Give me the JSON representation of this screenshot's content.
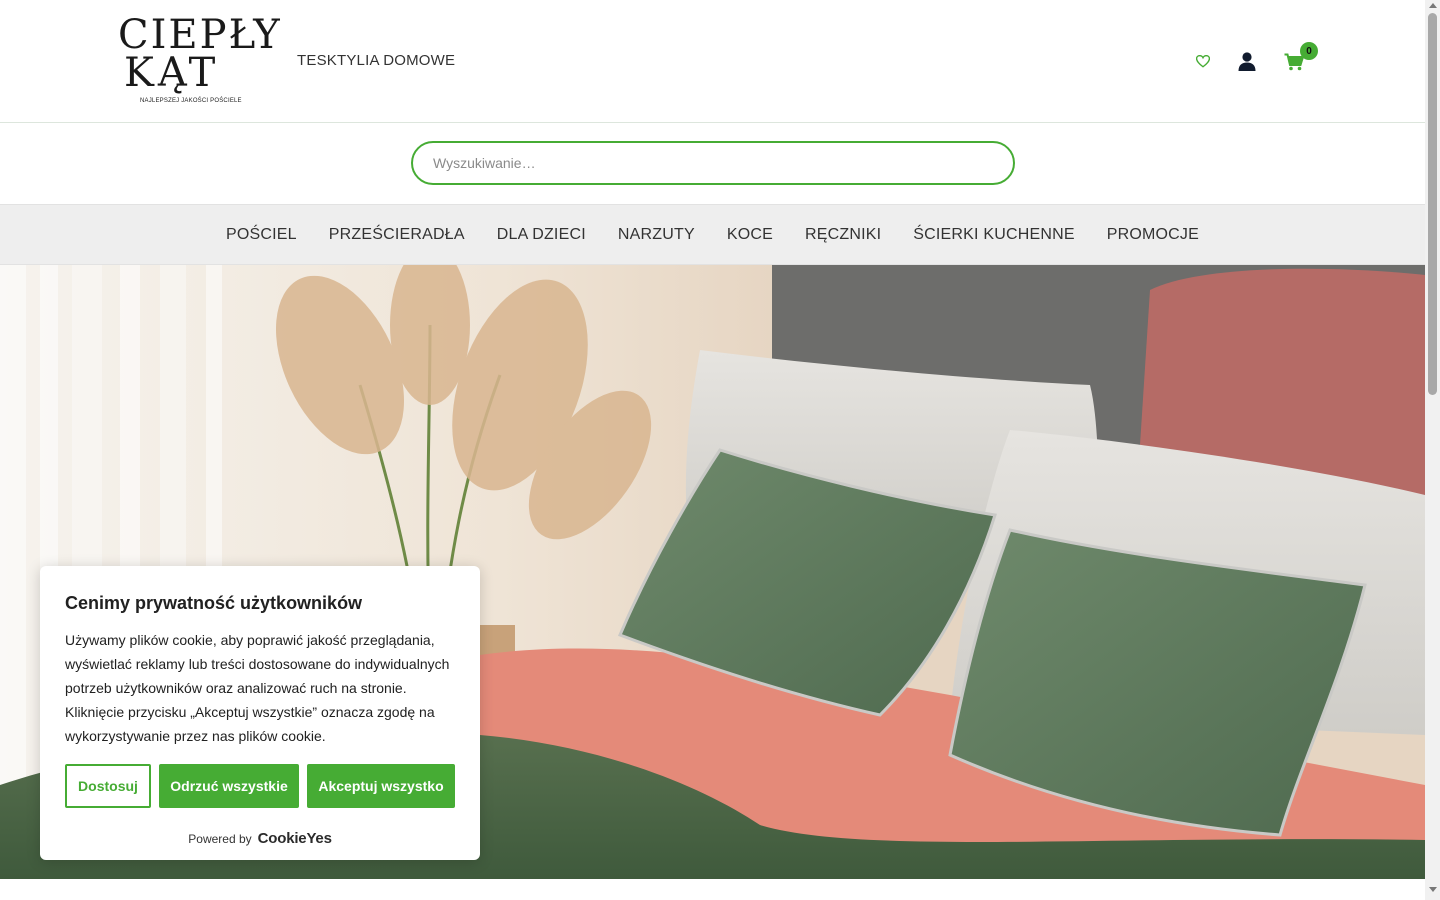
{
  "header": {
    "logo_line1": "CIEPŁY",
    "logo_line2": "KĄT",
    "logo_tagline": "NAJLEPSZEJ JAKOŚCI POŚCIELE",
    "tagline": "TESKTYLIA DOMOWE",
    "wishlist_icon": "heart-icon",
    "account_icon": "user-icon",
    "cart_icon": "cart-icon",
    "cart_count": "0",
    "accent_color": "#46ac34"
  },
  "search": {
    "placeholder": "Wyszukiwanie…"
  },
  "nav": {
    "items": [
      "POŚCIEL",
      "PRZEŚCIERADŁA",
      "DLA DZIECI",
      "NARZUTY",
      "KOCE",
      "RĘCZNIKI",
      "ŚCIERKI KUCHENNE",
      "PROMOCJE"
    ]
  },
  "cookie": {
    "title": "Cenimy prywatność użytkowników",
    "text": "Używamy plików cookie, aby poprawić jakość przeglądania, wyświetlać reklamy lub treści dostosowane do indywidualnych potrzeb użytkowników oraz analizować ruch na stronie. Kliknięcie przycisku „Akceptuj wszystkie” oznacza zgodę na wykorzystywanie przez nas plików cookie.",
    "customize_label": "Dostosuj",
    "reject_label": "Odrzuć wszystkie",
    "accept_label": "Akceptuj wszystko",
    "powered_by": "Powered by",
    "brand": "CookieYes"
  }
}
